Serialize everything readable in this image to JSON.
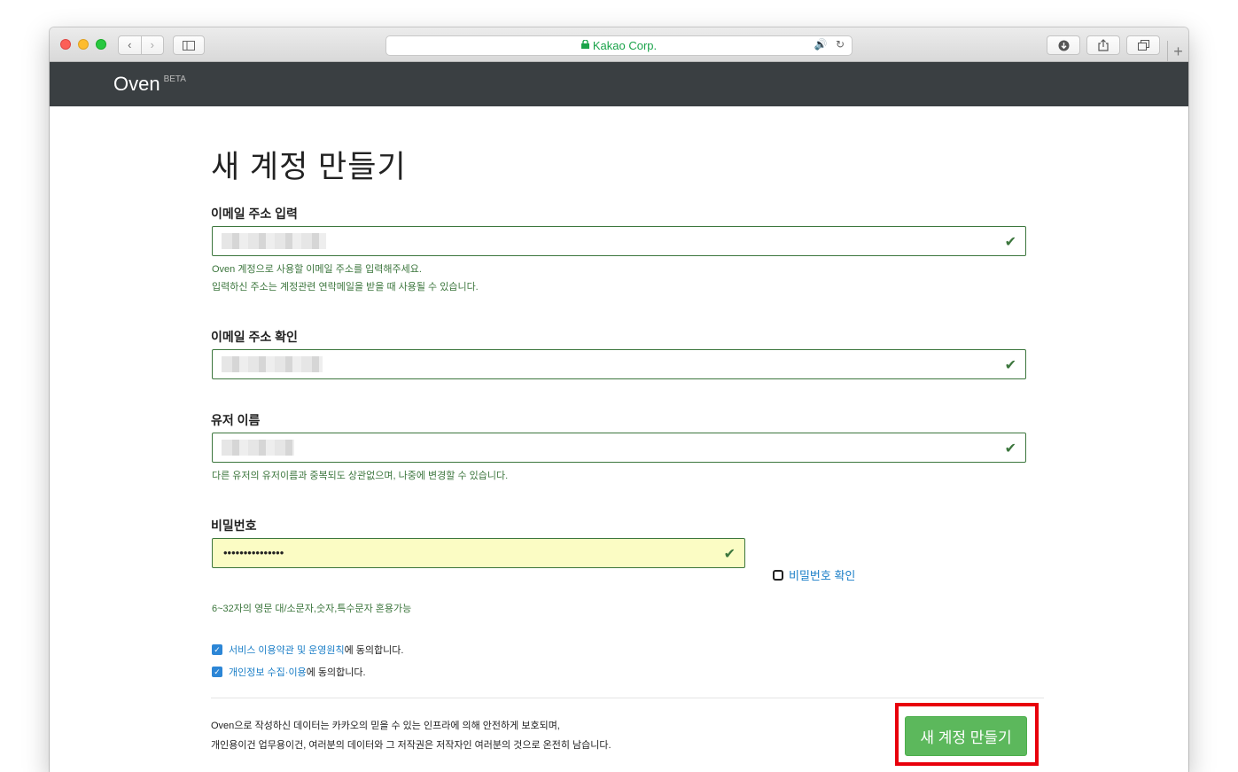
{
  "browser": {
    "nav_back": "‹",
    "nav_forward": "›",
    "url_text": "Kakao Corp.",
    "lock_icon": "🔒",
    "plus": "+"
  },
  "site": {
    "brand": "Oven",
    "brand_badge": "BETA"
  },
  "form": {
    "title": "새 계정 만들기",
    "email": {
      "label": "이메일 주소 입력",
      "help_line1": "Oven 계정으로 사용할 이메일 주소를 입력해주세요.",
      "help_line2": "입력하신 주소는 계정관련 연락메일을 받을 때 사용될 수 있습니다."
    },
    "email_confirm": {
      "label": "이메일 주소 확인"
    },
    "username": {
      "label": "유저 이름",
      "help": "다른 유저의 유저이름과 중복되도 상관없으며, 나중에 변경할 수 있습니다."
    },
    "password": {
      "label": "비밀번호",
      "masked_value": "•••••••••••••••",
      "help": "6~32자의 영문 대/소문자,숫자,특수문자 혼용가능",
      "show_label": "비밀번호 확인"
    },
    "agreements": [
      {
        "link": "서비스 이용약관 및 운영원칙",
        "suffix": "에 동의합니다.",
        "checked": true
      },
      {
        "link": "개인정보 수집·이용",
        "suffix": "에 동의합니다.",
        "checked": true
      }
    ],
    "footer_line1": "Oven으로 작성하신 데이터는 카카오의 믿을 수 있는 인프라에 의해 안전하게 보호되며,",
    "footer_line2": "개인용이건 업무용이건, 여러분의 데이터와 그 저작권은 저작자인 여러분의 것으로 온전히 남습니다.",
    "submit_label": "새 계정 만들기"
  },
  "colors": {
    "navbar": "#3a3f42",
    "valid_green": "#3c763d",
    "link_blue": "#1a7ec7",
    "submit_green": "#5cb85c",
    "highlight_red": "#e8000b"
  }
}
